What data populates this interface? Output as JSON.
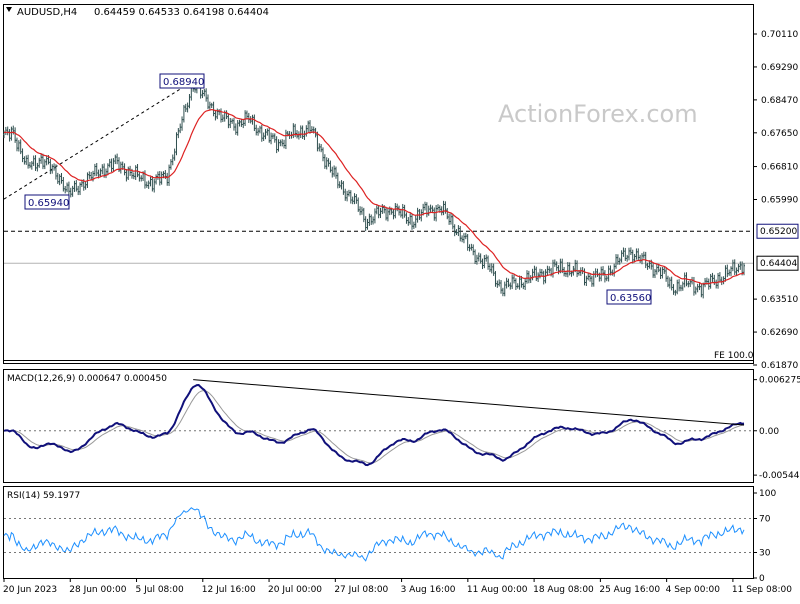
{
  "header": {
    "symbol_tf": "AUDUSD,H4",
    "ohlc": "0.64459 0.64533 0.64198 0.64404"
  },
  "watermark": "ActionForex.com",
  "colors": {
    "candles": "#2f4f4f",
    "ema": "#dd2222",
    "macd_main": "#10107a",
    "macd_signal": "#9a9a9a",
    "rsi": "#1e90ff",
    "level_box_border": "#10107a"
  },
  "chart_data": [
    {
      "type": "candlestick",
      "panel": "price",
      "ylim": [
        0.6187,
        0.7058
      ],
      "y_ticks": [
        "0.70110",
        "0.69290",
        "0.68470",
        "0.67650",
        "0.66810",
        "0.65990",
        "0.65200",
        "0.64404",
        "0.63510",
        "0.62690",
        "0.61870"
      ],
      "x_labels": [
        "20 Jun 2023",
        "28 Jun 00:00",
        "5 Jul 08:00",
        "12 Jul 16:00",
        "20 Jul 00:00",
        "27 Jul 08:00",
        "3 Aug 16:00",
        "11 Aug 00:00",
        "18 Aug 08:00",
        "25 Aug 16:00",
        "4 Sep 00:00",
        "11 Sep 08:00"
      ],
      "anchors": [
        [
          0,
          0.6755
        ],
        [
          5,
          0.677
        ],
        [
          12,
          0.668
        ],
        [
          20,
          0.67
        ],
        [
          30,
          0.6655
        ],
        [
          35,
          0.6612
        ],
        [
          42,
          0.664
        ],
        [
          52,
          0.6672
        ],
        [
          60,
          0.669
        ],
        [
          70,
          0.666
        ],
        [
          80,
          0.664
        ],
        [
          88,
          0.666
        ],
        [
          95,
          0.678
        ],
        [
          102,
          0.6889
        ],
        [
          110,
          0.684
        ],
        [
          118,
          0.68
        ],
        [
          125,
          0.6785
        ],
        [
          132,
          0.68
        ],
        [
          140,
          0.676
        ],
        [
          148,
          0.674
        ],
        [
          155,
          0.676
        ],
        [
          165,
          0.6778
        ],
        [
          172,
          0.671
        ],
        [
          180,
          0.664
        ],
        [
          188,
          0.66
        ],
        [
          195,
          0.6545
        ],
        [
          202,
          0.6565
        ],
        [
          210,
          0.6575
        ],
        [
          220,
          0.6545
        ],
        [
          228,
          0.6575
        ],
        [
          236,
          0.6575
        ],
        [
          244,
          0.6525
        ],
        [
          252,
          0.647
        ],
        [
          260,
          0.644
        ],
        [
          268,
          0.638
        ],
        [
          276,
          0.639
        ],
        [
          284,
          0.6405
        ],
        [
          292,
          0.642
        ],
        [
          300,
          0.643
        ],
        [
          308,
          0.642
        ],
        [
          316,
          0.6405
        ],
        [
          324,
          0.641
        ],
        [
          332,
          0.645
        ],
        [
          338,
          0.647
        ],
        [
          346,
          0.644
        ],
        [
          354,
          0.642
        ],
        [
          360,
          0.638
        ],
        [
          368,
          0.639
        ],
        [
          376,
          0.638
        ],
        [
          384,
          0.64
        ],
        [
          392,
          0.642
        ],
        [
          399,
          0.644
        ]
      ],
      "ema_period": 20,
      "labels": [
        {
          "text": "0.68940",
          "value": 0.6894
        },
        {
          "text": "0.65940",
          "value": 0.6594
        },
        {
          "text": "0.63560",
          "value": 0.6356
        }
      ],
      "level_line": {
        "value": 0.652,
        "label": "0.65200",
        "style": "dashed"
      },
      "current_price": {
        "value": 0.64404,
        "label": "0.64404"
      },
      "trendline": {
        "from": [
          0.66
        ],
        "to": [
          0.6894
        ]
      },
      "annotation": "FE 100.0"
    },
    {
      "type": "line",
      "panel": "macd",
      "title": "MACD(12,26,9) 0.000647 0.000450",
      "ylim": [
        -0.0058,
        0.0066
      ],
      "y_ticks": [
        "0.006275",
        "0.00",
        "-0.005446"
      ],
      "series": [
        {
          "name": "MACD",
          "role": "main"
        },
        {
          "name": "Signal",
          "role": "signal"
        }
      ],
      "trendline": {
        "from": 0.006275,
        "to": 0.0007
      }
    },
    {
      "type": "line",
      "panel": "rsi",
      "title": "RSI(14) 59.1977",
      "ylim": [
        0,
        100
      ],
      "y_ticks": [
        "100",
        "70",
        "30",
        "0"
      ],
      "levels": [
        70,
        30
      ]
    }
  ]
}
